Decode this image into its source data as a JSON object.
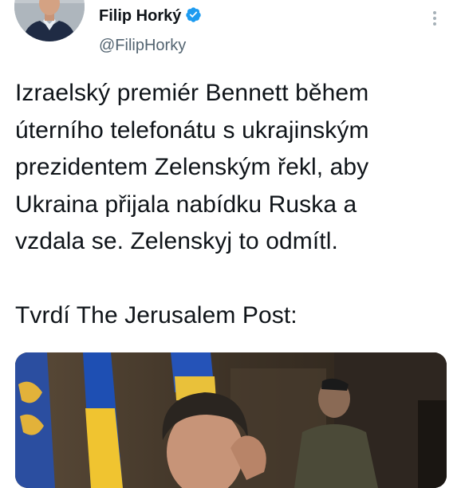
{
  "tweet": {
    "author": {
      "name": "Filip Horký",
      "handle": "@FilipHorky",
      "verified": true
    },
    "text": "Izraelský premiér Bennett během\núterního telefonátu s ukrajinským\nprezidentem Zelenským řekl, aby\nUkraina přijala nabídku Ruska a\nvzdala se. Zelenskyj to odmítl.\n\nTvrdí The Jerusalem Post:",
    "media": {
      "type": "photo"
    }
  },
  "colors": {
    "verified": "#1d9bf0",
    "text": "#0f1419",
    "handle": "#536471"
  },
  "icons": [
    "verified-badge-icon",
    "more-options-icon"
  ]
}
